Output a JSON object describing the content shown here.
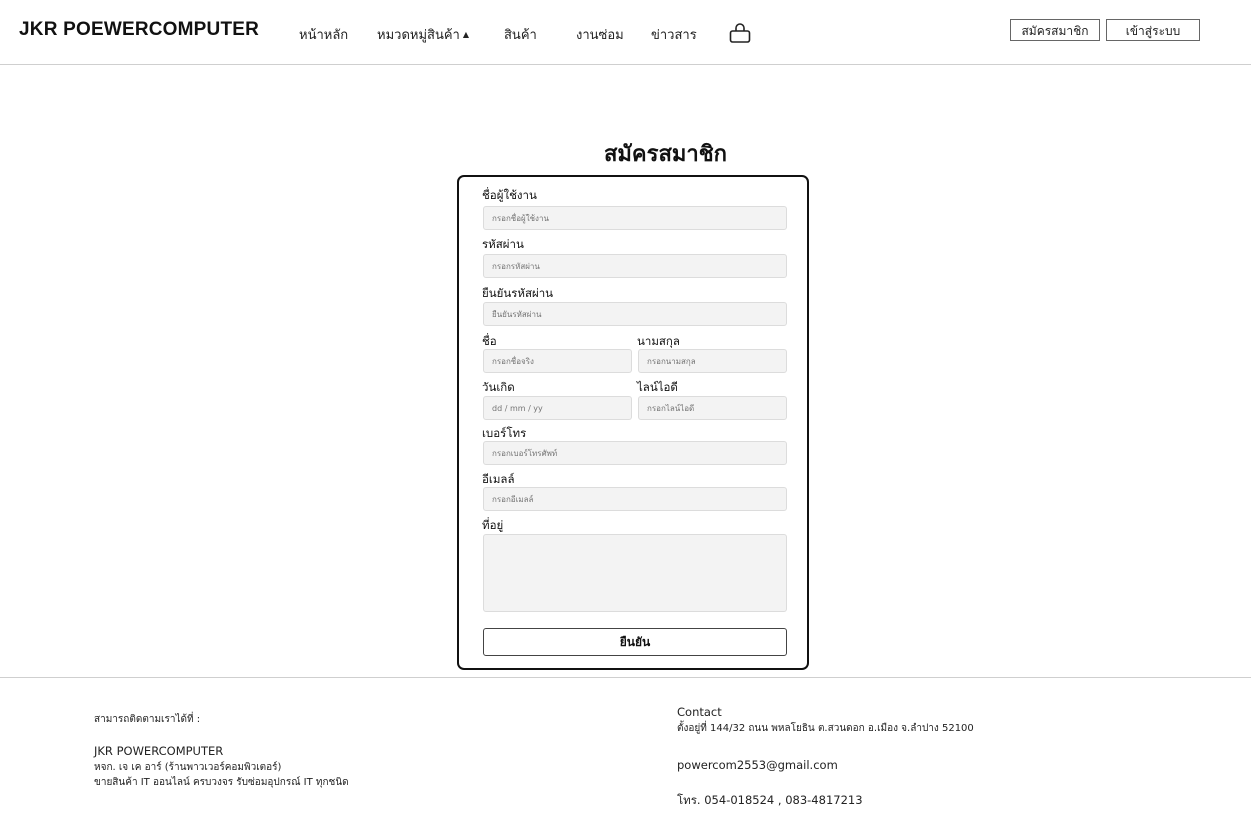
{
  "header": {
    "brand": "JKR POEWERCOMPUTER",
    "nav": [
      "หน้าหลัก",
      "หมวดหมู่สินค้า",
      "สินค้า",
      "งานซ่อม",
      "ข่าวสาร"
    ],
    "register_button": "สมัครสมาชิก",
    "login_button": "เข้าสู่ระบบ",
    "cart_icon": "basket-icon"
  },
  "page": {
    "title": "สมัครสมาชิก"
  },
  "form": {
    "username": {
      "label": "ชื่อผู้ใช้งาน",
      "placeholder": "กรอกชื่อผู้ใช้งาน"
    },
    "password": {
      "label": "รหัสผ่าน",
      "placeholder": "กรอกรหัสผ่าน"
    },
    "confirm_password": {
      "label": "ยืนยันรหัสผ่าน",
      "placeholder": "ยืนยันรหัสผ่าน"
    },
    "first_name": {
      "label": "ชื่อ",
      "placeholder": "กรอกชื่อจริง"
    },
    "last_name": {
      "label": "นามสกุล",
      "placeholder": "กรอกนามสกุล"
    },
    "birthday": {
      "label": "วันเกิด",
      "placeholder": "dd / mm / yy"
    },
    "line_id": {
      "label": "ไลน์ไอดี",
      "placeholder": "กรอกไลน์ไอดี"
    },
    "phone": {
      "label": "เบอร์โทร",
      "placeholder": "กรอกเบอร์โทรศัพท์"
    },
    "email": {
      "label": "อีเมลล์",
      "placeholder": "กรอกอีเมลล์"
    },
    "address": {
      "label": "ที่อยู่",
      "placeholder": ""
    },
    "submit": "ยืนยัน"
  },
  "footer": {
    "contact_us": "สามารถติดตามเราได้ที่ :",
    "company": "JKR POWERCOMPUTER",
    "company_full": "หจก. เจ เค อาร์ (ร้านพาวเวอร์คอมพิวเตอร์)",
    "description": "ขายสินค้า IT ออนไลน์ ครบวงจร รับซ่อมอุปกรณ์ IT ทุกชนิด",
    "contact_title": "Contact",
    "address": "ตั้งอยู่ที่ 144/32 ถนน พหลโยธิน ต.สวนดอก อ.เมือง จ.ลำปาง 52100",
    "email": "powercom2553@gmail.com",
    "phone": "โทร. 054-018524 , 083-4817213"
  }
}
